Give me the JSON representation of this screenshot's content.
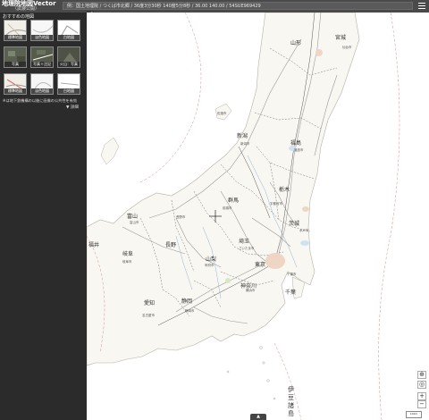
{
  "header": {
    "title": "地理院地図Vector",
    "subtitle": "（試験公開）",
    "search_placeholder": "例：国土地理院 / つくば市北郷 / 36度3分30秒 140度5分8秒 / 36.00 140.00 / 54SUE969429"
  },
  "sidebar": {
    "heading": "おすすめの地図",
    "tiles": [
      {
        "label": "標準地図"
      },
      {
        "label": "淡色地図"
      },
      {
        "label": "白地図"
      },
      {
        "label": "写真"
      },
      {
        "label": "写真＋注記"
      },
      {
        "label": "火山：写真"
      },
      {
        "label": "標準地図"
      },
      {
        "label": "淡色地図"
      },
      {
        "label": "白地図"
      }
    ],
    "note": "※は地下鉄機構の以後に画像の公共性を有効",
    "detail": "▼ 詳細"
  },
  "map": {
    "prefectures": [
      "山形",
      "宮城",
      "新潟",
      "福島",
      "富山",
      "群馬",
      "栃木",
      "茨城",
      "長野",
      "埼玉",
      "山梨",
      "東京",
      "千葉",
      "岐阜",
      "静岡",
      "愛知",
      "神奈川",
      "福井"
    ],
    "cities": [
      "新潟市",
      "福島市",
      "前橋市",
      "宇都宮市",
      "水戸市",
      "さいたま市",
      "千葉市",
      "横浜市",
      "甲府市",
      "長野市",
      "富山市",
      "静岡市",
      "名古屋市",
      "岐阜市",
      "佐渡市",
      "仙台市"
    ],
    "islands_label": "伊豆諸島",
    "controls": {
      "zoom_in": "+",
      "zoom_out": "−"
    },
    "scale_text": "10km",
    "bottom_toggle": "▲",
    "sidebar_toggle": "◀"
  }
}
